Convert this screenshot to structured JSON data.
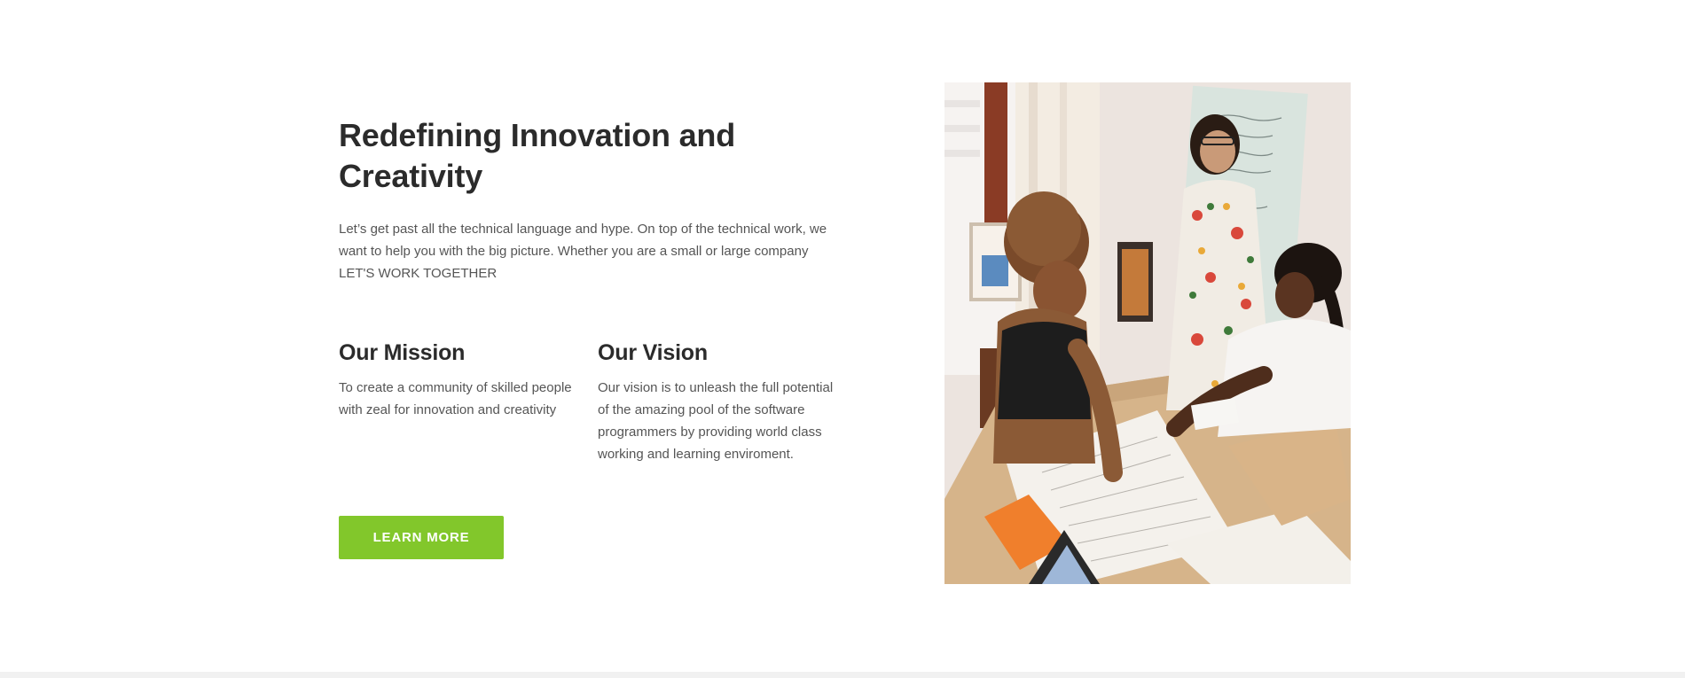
{
  "hero": {
    "title": "Redefining Innovation and Creativity",
    "intro_lines": [
      "Let’s get past all the technical language and hype. On top of the technical work, we",
      "want to help you with the big picture. Whether you are a small or large company",
      "LET'S WORK TOGETHER"
    ],
    "mission": {
      "title": "Our Mission",
      "text": "To create a community of skilled people with zeal for innovation and creativity"
    },
    "vision": {
      "title": "Our Vision",
      "text": "Our vision is to unleash the full potential of the amazing pool of the software programmers by providing world class working and learning enviroment."
    },
    "cta_label": "LEARN MORE",
    "accent_color": "#82c72b"
  },
  "image": {
    "description_icon": "team-meeting-photo"
  }
}
